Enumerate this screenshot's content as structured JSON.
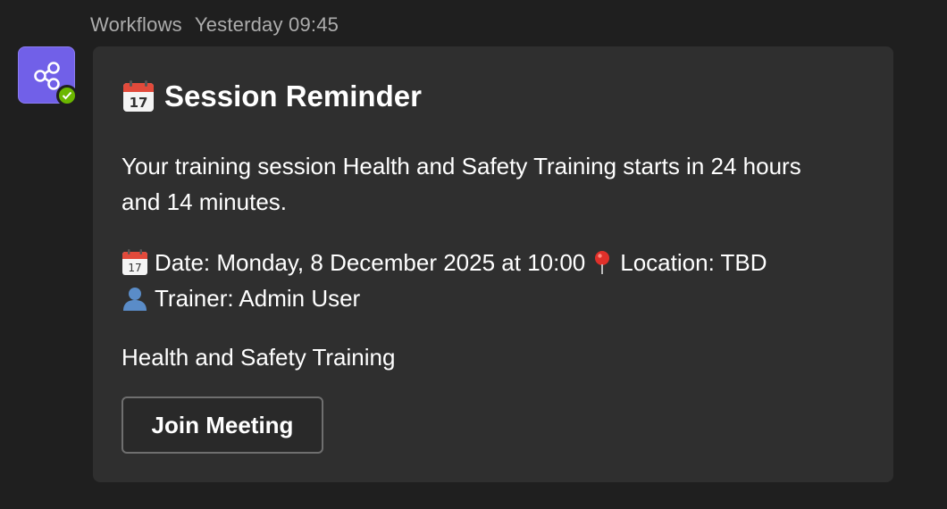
{
  "header": {
    "sender": "Workflows",
    "timestamp": "Yesterday 09:45"
  },
  "avatar": {
    "icon": "share-nodes-icon",
    "color": "#7160e8",
    "presence": "available",
    "presence_color": "#6bb700"
  },
  "card": {
    "title_icon": "calendar-icon",
    "title": "Session Reminder",
    "body": "Your training session Health and Safety Training starts in 24 hours and 14 minutes.",
    "date_icon": "calendar-icon",
    "date_text": "Date: Monday, 8 December 2025 at 10:00",
    "location_icon": "pin-icon",
    "location_text": "Location: TBD",
    "trainer_icon": "user-icon",
    "trainer_text": "Trainer: Admin User",
    "summary": "Health and Safety Training",
    "button_label": "Join Meeting"
  }
}
